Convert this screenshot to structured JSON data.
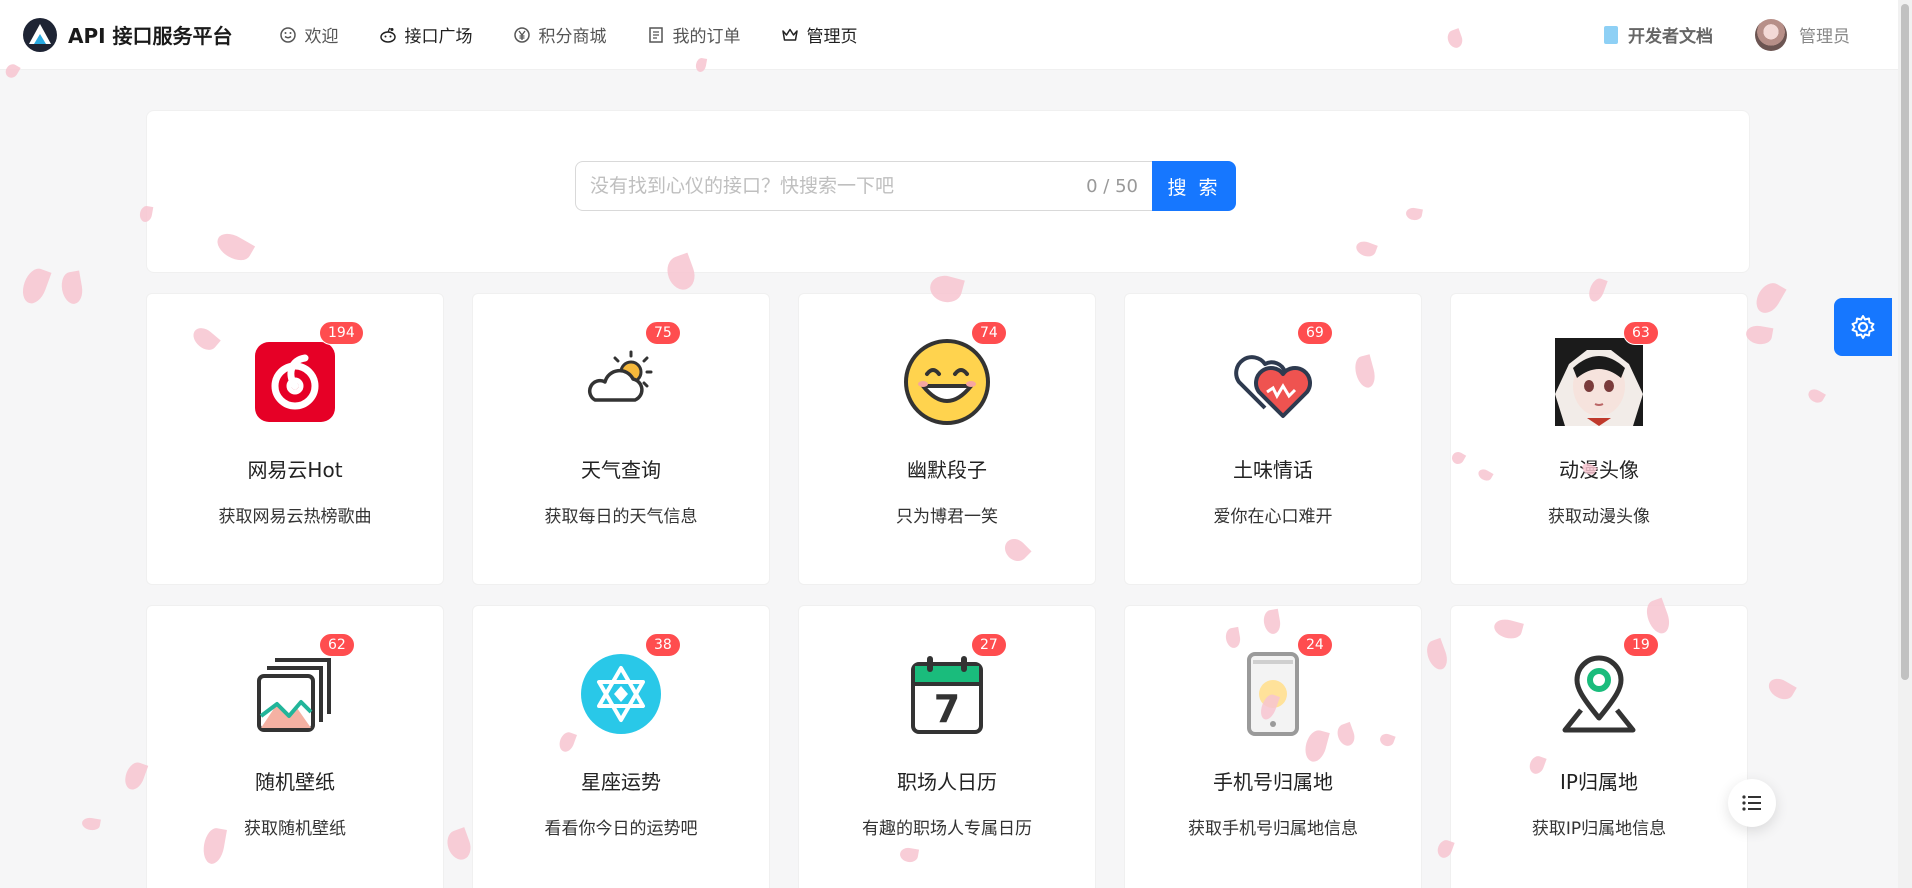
{
  "header": {
    "title": "API 接口服务平台",
    "nav": [
      {
        "label": "欢迎",
        "icon": "smile-icon"
      },
      {
        "label": "接口广场",
        "icon": "reddit-icon"
      },
      {
        "label": "积分商城",
        "icon": "yen-circle-icon"
      },
      {
        "label": "我的订单",
        "icon": "order-list-icon"
      },
      {
        "label": "管理页",
        "icon": "crown-icon"
      }
    ],
    "docs_label": "开发者文档",
    "user_name": "管理员"
  },
  "search": {
    "placeholder": "没有找到心仪的接口？快搜索一下吧",
    "count": "0 / 50",
    "button_label": "搜 索"
  },
  "cards": [
    {
      "title": "网易云Hot",
      "desc": "获取网易云热榜歌曲",
      "badge": "194",
      "icon": "netease-music-icon"
    },
    {
      "title": "天气查询",
      "desc": "获取每日的天气信息",
      "badge": "75",
      "icon": "weather-icon"
    },
    {
      "title": "幽默段子",
      "desc": "只为博君一笑",
      "badge": "74",
      "icon": "smile-face-icon"
    },
    {
      "title": "土味情话",
      "desc": "爱你在心口难开",
      "badge": "69",
      "icon": "hearts-icon"
    },
    {
      "title": "动漫头像",
      "desc": "获取动漫头像",
      "badge": "63",
      "icon": "anime-avatar-icon"
    },
    {
      "title": "随机壁纸",
      "desc": "获取随机壁纸",
      "badge": "62",
      "icon": "wallpaper-icon"
    },
    {
      "title": "星座运势",
      "desc": "看看你今日的运势吧",
      "badge": "38",
      "icon": "star-of-david-icon"
    },
    {
      "title": "职场人日历",
      "desc": "有趣的职场人专属日历",
      "badge": "27",
      "icon": "calendar-icon",
      "calendar_day": "7"
    },
    {
      "title": "手机号归属地",
      "desc": "获取手机号归属地信息",
      "badge": "24",
      "icon": "phone-icon"
    },
    {
      "title": "IP归属地",
      "desc": "获取IP归属地信息",
      "badge": "19",
      "icon": "location-pin-icon"
    }
  ],
  "colors": {
    "primary": "#1677ff",
    "badge": "#ff4d4f",
    "petal": "#f7c4d0"
  }
}
